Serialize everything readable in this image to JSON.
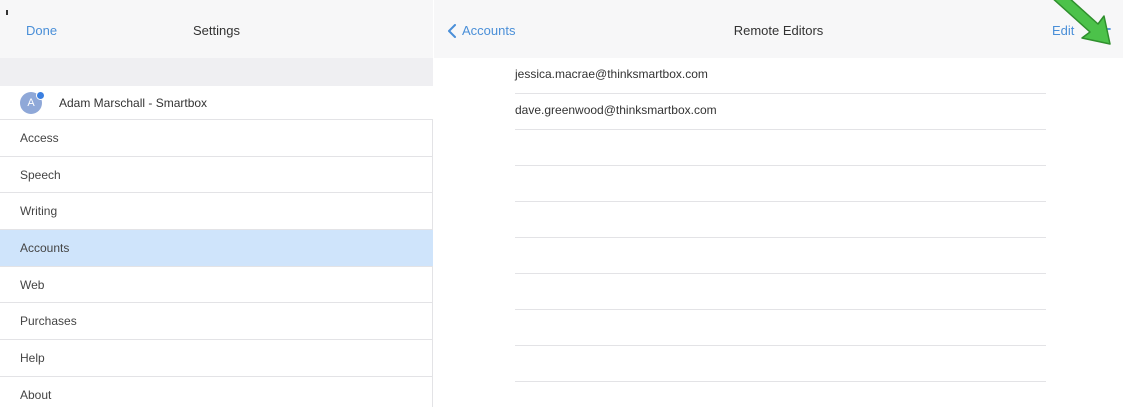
{
  "left_pane": {
    "done_label": "Done",
    "title": "Settings",
    "account": {
      "avatar_initial": "A",
      "name": "Adam Marschall - Smartbox"
    },
    "menu_items": [
      {
        "label": "Access"
      },
      {
        "label": "Speech"
      },
      {
        "label": "Writing"
      },
      {
        "label": "Accounts",
        "selected": true
      },
      {
        "label": "Web"
      },
      {
        "label": "Purchases"
      },
      {
        "label": "Help"
      },
      {
        "label": "About"
      }
    ]
  },
  "right_pane": {
    "back_label": "Accounts",
    "title": "Remote Editors",
    "edit_label": "Edit",
    "remote_editors": [
      {
        "email": "jessica.macrae@thinksmartbox.com"
      },
      {
        "email": "dave.greenwood@thinksmartbox.com"
      }
    ]
  },
  "colors": {
    "accent": "#4a8fd8",
    "selected_row": "#cfe4fb",
    "annotation_arrow": "#4cc24a"
  },
  "icons": {
    "back": "chevron-left-icon",
    "add": "plus-icon",
    "annotation": "green-arrow-icon"
  }
}
